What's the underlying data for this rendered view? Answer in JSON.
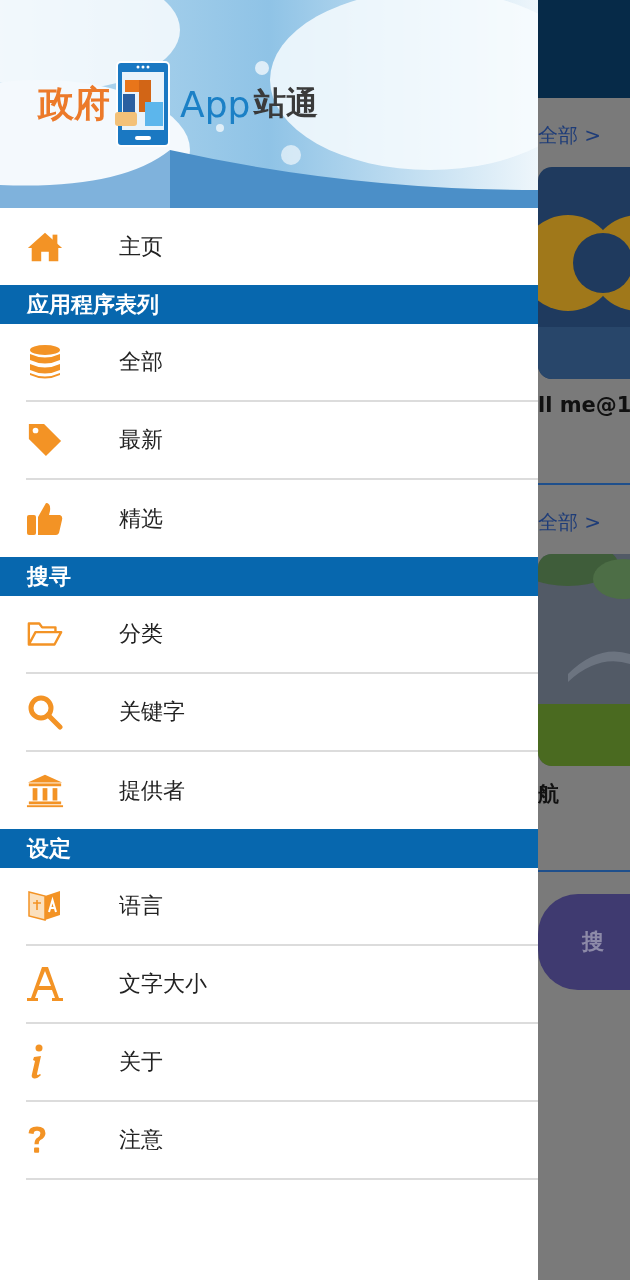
{
  "drawer": {
    "logo": {
      "text_1": "政府",
      "text_2": "App",
      "text_3": "站通"
    },
    "menu": [
      {
        "kind": "item",
        "label": "主页"
      },
      {
        "kind": "section",
        "label": "应用程序表列"
      },
      {
        "kind": "item",
        "label": "全部"
      },
      {
        "kind": "item",
        "label": "最新"
      },
      {
        "kind": "item",
        "label": "精选"
      },
      {
        "kind": "section",
        "label": "搜寻"
      },
      {
        "kind": "item",
        "label": "分类"
      },
      {
        "kind": "item",
        "label": "关键字"
      },
      {
        "kind": "item",
        "label": "提供者"
      },
      {
        "kind": "section",
        "label": "设定"
      },
      {
        "kind": "item",
        "label": "语言"
      },
      {
        "kind": "item",
        "label": "文字大小"
      },
      {
        "kind": "item",
        "label": "关于"
      },
      {
        "kind": "item",
        "label": "注意"
      }
    ]
  },
  "background_page": {
    "sections": [
      {
        "link": "全部 >",
        "card_title": "ll me@1"
      },
      {
        "link": "全部 >",
        "card_title": "航"
      }
    ],
    "button": "搜"
  }
}
